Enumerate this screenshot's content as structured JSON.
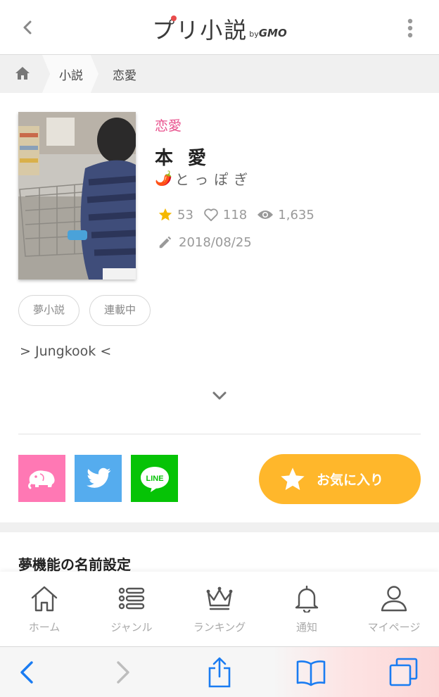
{
  "header": {
    "logo_text": "プリ小説",
    "logo_by": "by",
    "logo_gmo": "GMO",
    "back_icon": "chevron-left-icon",
    "menu_icon": "vertical-dots-icon"
  },
  "breadcrumb": {
    "home_icon": "home-icon",
    "items": [
      {
        "label": "小説"
      },
      {
        "label": "恋愛"
      }
    ]
  },
  "book": {
    "genre": "恋愛",
    "title": "本 愛",
    "author_emoji": "🌶️",
    "author": "とっぽぎ",
    "stats": {
      "stars": "53",
      "likes": "118",
      "views": "1,635"
    },
    "updated": "2018/08/25",
    "tags": [
      "夢小説",
      "連載中"
    ],
    "description": "> Jungkook <"
  },
  "share": {
    "buttons": [
      {
        "name": "elephant",
        "color": "#ff78b4"
      },
      {
        "name": "twitter",
        "color": "#55acee"
      },
      {
        "name": "line",
        "color": "#06c306",
        "text": "LINE"
      }
    ],
    "favorite_label": "お気に入り",
    "favorite_color": "#ffb72b"
  },
  "section": {
    "title": "夢機能の名前設定"
  },
  "bottom_nav": [
    {
      "label": "ホーム",
      "icon": "home-icon"
    },
    {
      "label": "ジャンル",
      "icon": "list-icon"
    },
    {
      "label": "ランキング",
      "icon": "crown-icon"
    },
    {
      "label": "通知",
      "icon": "bell-icon"
    },
    {
      "label": "マイページ",
      "icon": "user-icon"
    }
  ],
  "browser_toolbar": [
    {
      "icon": "back-arrow-icon",
      "enabled": true
    },
    {
      "icon": "forward-arrow-icon",
      "enabled": false
    },
    {
      "icon": "share-icon",
      "enabled": true
    },
    {
      "icon": "bookmarks-icon",
      "enabled": true
    },
    {
      "icon": "tabs-icon",
      "enabled": true
    }
  ],
  "colors": {
    "accent_pink": "#e8508c",
    "favorite": "#ffb72b",
    "star": "#f5b800",
    "ios_blue": "#1a7cf2"
  }
}
